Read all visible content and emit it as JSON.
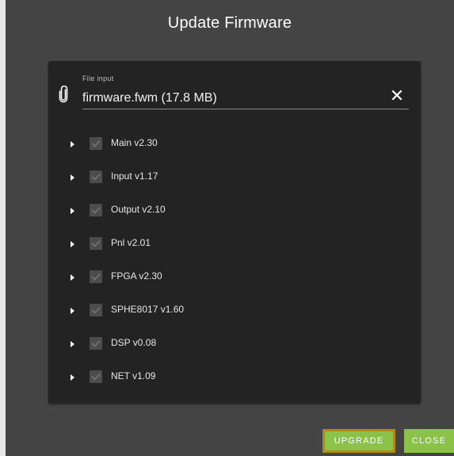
{
  "dialog": {
    "title": "Update Firmware"
  },
  "file_input": {
    "label": "File input",
    "value": "firmware.fwm (17.8 MB)",
    "clear_icon": "close-icon",
    "attach_icon": "paperclip-icon"
  },
  "components": [
    {
      "label": "Main v2.30",
      "checked": true
    },
    {
      "label": "Input v1.17",
      "checked": true
    },
    {
      "label": "Output v2.10",
      "checked": true
    },
    {
      "label": "Pnl v2.01",
      "checked": true
    },
    {
      "label": "FPGA v2.30",
      "checked": true
    },
    {
      "label": "SPHE8017 v1.60",
      "checked": true
    },
    {
      "label": "DSP v0.08",
      "checked": true
    },
    {
      "label": "NET v1.09",
      "checked": true
    }
  ],
  "actions": {
    "upgrade_label": "UPGRADE",
    "close_label": "CLOSE"
  },
  "colors": {
    "dialog_bg": "#444444",
    "panel_bg": "#232323",
    "button_bg": "#8bc34a",
    "focus_outline": "#b08a12"
  }
}
